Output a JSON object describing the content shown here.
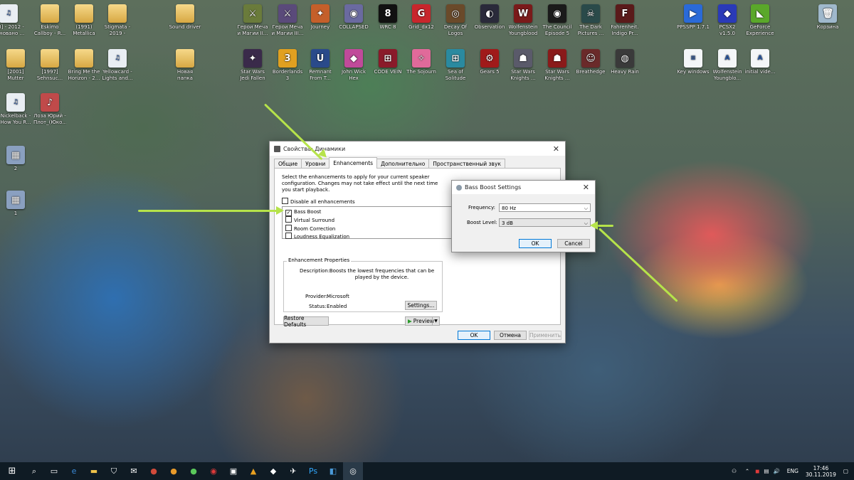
{
  "desktop_icons": [
    {
      "label": "[13] - 2012 - Основано ...",
      "color": "#e9eef3",
      "glyph": "♫",
      "kind": "doc"
    },
    {
      "label": "Eskimo Callboy - R...",
      "color": "",
      "glyph": "",
      "kind": "folder"
    },
    {
      "label": "(1991) Metallica",
      "color": "",
      "glyph": "",
      "kind": "folder"
    },
    {
      "label": "Stigmata - 2019 - Кале...",
      "color": "",
      "glyph": "",
      "kind": "folder"
    },
    {
      "label": "Sound driver",
      "color": "",
      "glyph": "",
      "kind": "folder"
    },
    {
      "label": "Герои Меча и Магии II...",
      "color": "#6a7b3b",
      "glyph": "⚔",
      "kind": "app"
    },
    {
      "label": "Герои Меча и Магии III...",
      "color": "#5a4a7a",
      "glyph": "⚔",
      "kind": "app"
    },
    {
      "label": "Journey",
      "color": "#c45f2a",
      "glyph": "✦",
      "kind": "app"
    },
    {
      "label": "COLLAPSED",
      "color": "#6a6aa0",
      "glyph": "◉",
      "kind": "app"
    },
    {
      "label": "WRC 8",
      "color": "#111111",
      "glyph": "8",
      "kind": "app"
    },
    {
      "label": "Grid_dx12",
      "color": "#c8262c",
      "glyph": "G",
      "kind": "app"
    },
    {
      "label": "Decay Of Logos",
      "color": "#6a4a2a",
      "glyph": "◎",
      "kind": "app"
    },
    {
      "label": "Observation",
      "color": "#2a2a3a",
      "glyph": "◐",
      "kind": "app"
    },
    {
      "label": "Wolfenstein Youngblood",
      "color": "#7a1a1a",
      "glyph": "W",
      "kind": "app"
    },
    {
      "label": "The Council Episode 5",
      "color": "#1a1a1a",
      "glyph": "◉",
      "kind": "app"
    },
    {
      "label": "The Dark Pictures ...",
      "color": "#2a4a4a",
      "glyph": "☠",
      "kind": "app"
    },
    {
      "label": "Fahrenheit. Indigo Pr...",
      "color": "#5a1a1a",
      "glyph": "F",
      "kind": "app"
    },
    {
      "label": "PPSSPP 1.7.1",
      "color": "#2a6ad8",
      "glyph": "▶",
      "kind": "app"
    },
    {
      "label": "PCSX2 v1.5.0",
      "color": "#2a3ab8",
      "glyph": "◆",
      "kind": "app"
    },
    {
      "label": "GeForce Experience",
      "color": "#5aa82a",
      "glyph": "◣",
      "kind": "app"
    },
    {
      "label": "Корзина",
      "color": "#9fb8cc",
      "glyph": "🗑",
      "kind": "app"
    },
    {
      "label": "[2001] Mutter",
      "color": "",
      "glyph": "",
      "kind": "folder"
    },
    {
      "label": "[1997] Sehnsuc...",
      "color": "",
      "glyph": "",
      "kind": "folder"
    },
    {
      "label": "Bring Me the Horizon - 2...",
      "color": "",
      "glyph": "",
      "kind": "folder"
    },
    {
      "label": "Yellowcard - Lights and...",
      "color": "#e9eef3",
      "glyph": "♫",
      "kind": "doc"
    },
    {
      "label": "Новая папка",
      "color": "",
      "glyph": "",
      "kind": "folder"
    },
    {
      "label": "Star Wars Jedi Fallen Order",
      "color": "#3a2a4a",
      "glyph": "✦",
      "kind": "app"
    },
    {
      "label": "Borderlands 3",
      "color": "#e0a020",
      "glyph": "3",
      "kind": "app"
    },
    {
      "label": "Remnant From T...",
      "color": "#2a4a8a",
      "glyph": "U",
      "kind": "app"
    },
    {
      "label": "John Wick Hex",
      "color": "#c04a9a",
      "glyph": "◆",
      "kind": "app"
    },
    {
      "label": "CODE VEIN",
      "color": "#8a1a2a",
      "glyph": "⊞",
      "kind": "app"
    },
    {
      "label": "The Sojourn",
      "color": "#e06a9a",
      "glyph": "✧",
      "kind": "app"
    },
    {
      "label": "Sea of Solitude",
      "color": "#2a8aa0",
      "glyph": "⊞",
      "kind": "app"
    },
    {
      "label": "Gears 5",
      "color": "#a01a1a",
      "glyph": "⚙",
      "kind": "app"
    },
    {
      "label": "Star Wars Knights ...",
      "color": "#5a5a6a",
      "glyph": "☗",
      "kind": "app"
    },
    {
      "label": "Star Wars Knights ...",
      "color": "#8a1a1a",
      "glyph": "☗",
      "kind": "app"
    },
    {
      "label": "Breathedge",
      "color": "#6a2a2a",
      "glyph": "☺",
      "kind": "app"
    },
    {
      "label": "Heavy Rain",
      "color": "#3a3a3a",
      "glyph": "◍",
      "kind": "app"
    },
    {
      "label": "Key windows",
      "color": "#f4f6f8",
      "glyph": "≡",
      "kind": "doc"
    },
    {
      "label": "Wolfenstein Youngblo...",
      "color": "#f4f6f8",
      "glyph": "A",
      "kind": "doc"
    },
    {
      "label": "initial vide...",
      "color": "#f4f6f8",
      "glyph": "A",
      "kind": "doc"
    },
    {
      "label": "Nickelback - How You R...",
      "color": "#e9eef3",
      "glyph": "♫",
      "kind": "doc"
    },
    {
      "label": "Лоза Юрий - Плот_(Юко...",
      "color": "#c04a4a",
      "glyph": "♪",
      "kind": "app"
    },
    {
      "label": "2",
      "color": "#8aa0c0",
      "glyph": "▦",
      "kind": "app"
    },
    {
      "label": "1",
      "color": "#8aa0c0",
      "glyph": "▦",
      "kind": "app"
    }
  ],
  "dialog_main": {
    "title": "Свойства: Динамики",
    "tabs": [
      "Общие",
      "Уровни",
      "Enhancements",
      "Дополнительно",
      "Пространственный звук"
    ],
    "intro": "Select the enhancements to apply for your current speaker configuration. Changes may not take effect until the next time you start playback.",
    "disable_all": "Disable all enhancements",
    "enhancements": [
      {
        "label": "Bass Boost",
        "checked": true
      },
      {
        "label": "Virtual Surround",
        "checked": false
      },
      {
        "label": "Room Correction",
        "checked": false
      },
      {
        "label": "Loudness Equalization",
        "checked": false
      }
    ],
    "props_title": "Enhancement Properties",
    "desc_label": "Description:",
    "desc_text": "Boosts the lowest frequencies that can be played by the device.",
    "provider_label": "Provider:",
    "provider_value": "Microsoft",
    "status_label": "Status:",
    "status_value": "Enabled",
    "settings_btn": "Settings...",
    "restore_btn": "Restore Defaults",
    "preview_btn": "Preview",
    "ok_btn": "OK",
    "cancel_btn": "Отмена",
    "apply_btn": "Применить"
  },
  "dialog_bass": {
    "title": "Bass Boost Settings",
    "freq_label": "Frequency:",
    "freq_value": "80 Hz",
    "level_label": "Boost Level:",
    "level_value": "3 dB",
    "ok_btn": "OK",
    "cancel_btn": "Cancel"
  },
  "taskbar": {
    "lang": "ENG",
    "time": "17:46",
    "date": "30.11.2019"
  },
  "colors": {
    "accent": "#0078d7",
    "arrow": "#b6e34a",
    "taskbar": "#0f1b24"
  }
}
